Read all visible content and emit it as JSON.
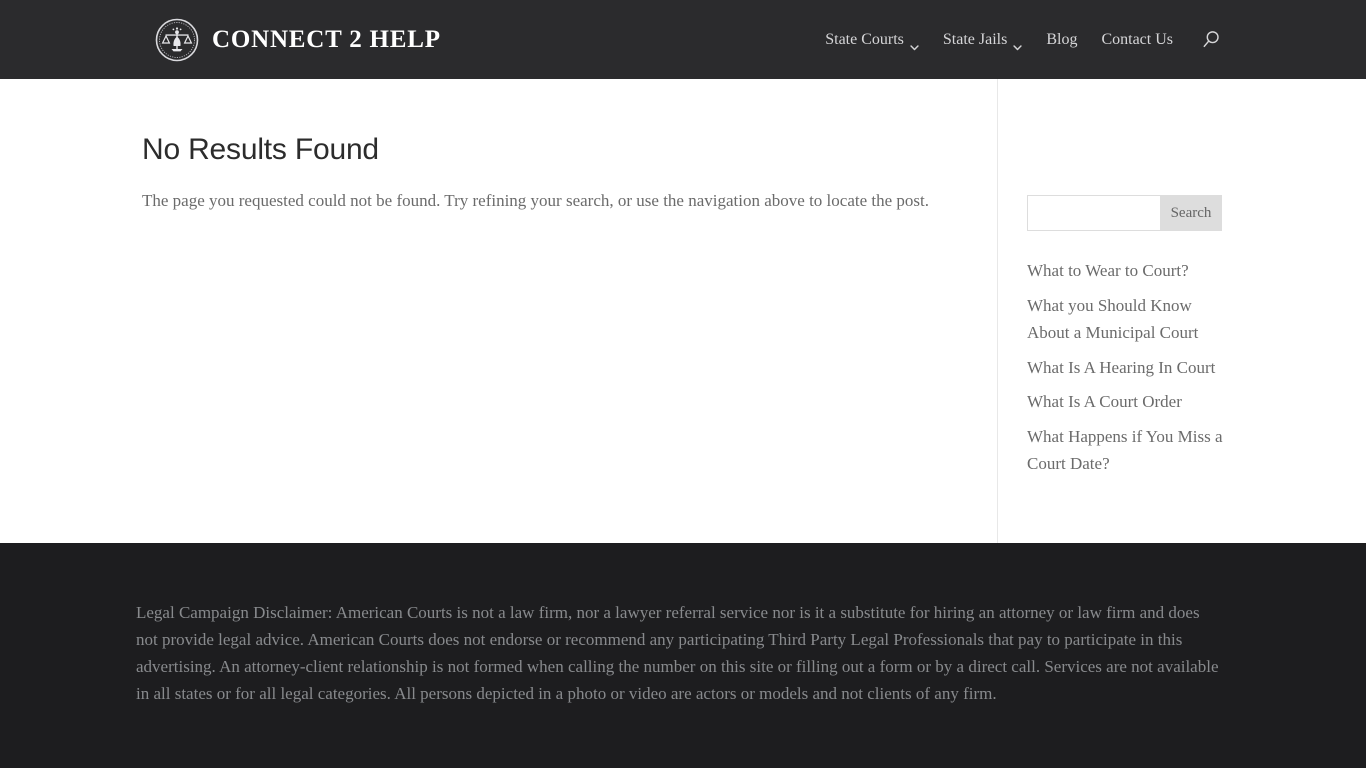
{
  "header": {
    "brand": {
      "name": "CONNECT 2 HELP",
      "logo_icon": "scales-of-justice-seal-icon"
    },
    "nav": [
      {
        "label": "State Courts",
        "has_dropdown": true,
        "icon": "chevron-down-icon"
      },
      {
        "label": "State Jails",
        "has_dropdown": true,
        "icon": "chevron-down-icon"
      },
      {
        "label": "Blog",
        "has_dropdown": false
      },
      {
        "label": "Contact Us",
        "has_dropdown": false
      }
    ],
    "search_icon": "search-icon",
    "background_color": "#2b2b2d",
    "text_color": "#d5d5d7"
  },
  "main": {
    "title": "No Results Found",
    "description": "The page you requested could not be found. Try refining your search, or use the navigation above to locate the post."
  },
  "sidebar": {
    "search": {
      "value": "",
      "placeholder": "",
      "button_label": "Search",
      "button_color": "#dddddd"
    },
    "recent_posts": [
      {
        "label": "What to Wear to Court?"
      },
      {
        "label": "What you Should Know About a Municipal Court"
      },
      {
        "label": "What Is A Hearing In Court"
      },
      {
        "label": "What Is A Court Order"
      },
      {
        "label": "What Happens if You Miss a Court Date?"
      }
    ]
  },
  "footer": {
    "disclaimer": "Legal Campaign Disclaimer: American Courts is not a law firm, nor a lawyer referral service nor is it a substitute for hiring an attorney or law firm and does not provide legal advice. American Courts does not endorse or recommend any participating Third Party Legal Professionals that pay to participate in this advertising. An attorney-client relationship is not formed when calling the number on this site or filling out a form or by a direct call. Services are not available in all states or for all legal categories. All persons depicted in a photo or video are actors or models and not clients of any firm.",
    "background_color": "#1d1d1f",
    "text_color": "#888a8d"
  }
}
